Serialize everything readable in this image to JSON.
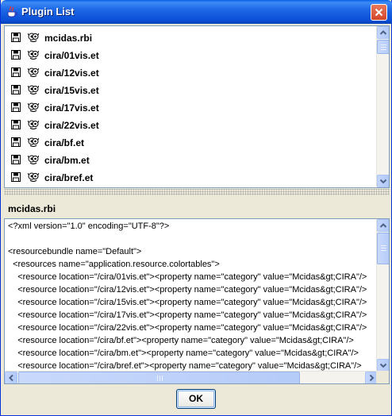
{
  "window": {
    "title": "Plugin List"
  },
  "plugins": [
    {
      "name": "mcidas.rbi"
    },
    {
      "name": "cira/01vis.et"
    },
    {
      "name": "cira/12vis.et"
    },
    {
      "name": "cira/15vis.et"
    },
    {
      "name": "cira/17vis.et"
    },
    {
      "name": "cira/22vis.et"
    },
    {
      "name": "cira/bf.et"
    },
    {
      "name": "cira/bm.et"
    },
    {
      "name": "cira/bref.et"
    }
  ],
  "detail": {
    "file_name": "mcidas.rbi",
    "lines": [
      "<?xml version=\"1.0\" encoding=\"UTF-8\"?>",
      "",
      "<resourcebundle name=\"Default\">",
      "  <resources name=\"application.resource.colortables\">",
      "    <resource location=\"/cira/01vis.et\"><property name=\"category\" value=\"Mcidas&gt;CIRA\"/>",
      "    <resource location=\"/cira/12vis.et\"><property name=\"category\" value=\"Mcidas&gt;CIRA\"/>",
      "    <resource location=\"/cira/15vis.et\"><property name=\"category\" value=\"Mcidas&gt;CIRA\"/>",
      "    <resource location=\"/cira/17vis.et\"><property name=\"category\" value=\"Mcidas&gt;CIRA\"/>",
      "    <resource location=\"/cira/22vis.et\"><property name=\"category\" value=\"Mcidas&gt;CIRA\"/>",
      "    <resource location=\"/cira/bf.et\"><property name=\"category\" value=\"Mcidas&gt;CIRA\"/>",
      "    <resource location=\"/cira/bm.et\"><property name=\"category\" value=\"Mcidas&gt;CIRA\"/>",
      "    <resource location=\"/cira/bref.et\"><property name=\"category\" value=\"Mcidas&gt;CIRA\"/>"
    ]
  },
  "buttons": {
    "ok_label": "OK"
  },
  "icons": {
    "title": "java-cup-icon",
    "close": "close-icon",
    "row_left": "floppy-disk-icon",
    "row_right": "plugin-bug-icon"
  },
  "colors": {
    "titlebar": "#0A4FD6",
    "close": "#D2462A",
    "window_bg": "#ECE9D8",
    "border": "#7F9DB9"
  }
}
